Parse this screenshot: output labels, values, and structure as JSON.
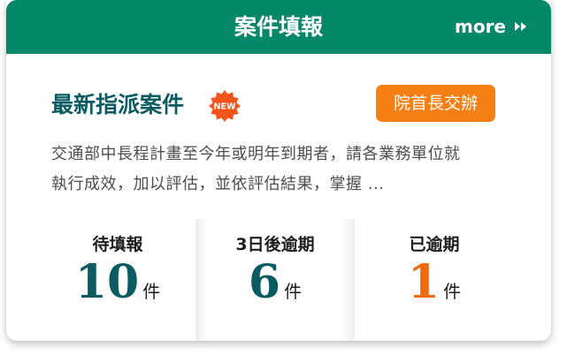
{
  "header": {
    "title": "案件填報",
    "more_label": "more",
    "color": "#05876a"
  },
  "latest": {
    "title": "最新指派案件",
    "new_badge": "NEW",
    "tag": "院首長交辦",
    "tag_color": "#f67f14",
    "summary_line1": "交通部中長程計畫至今年或明年到期者，請各業務單位就",
    "summary_line2": "執行成效，加以評估，並依評估結果，掌握 ..."
  },
  "stats": [
    {
      "label": "待填報",
      "value": "10",
      "unit": "件"
    },
    {
      "label": "3日後逾期",
      "value": "6",
      "unit": "件"
    },
    {
      "label": "已逾期",
      "value": "1",
      "unit": "件"
    }
  ]
}
